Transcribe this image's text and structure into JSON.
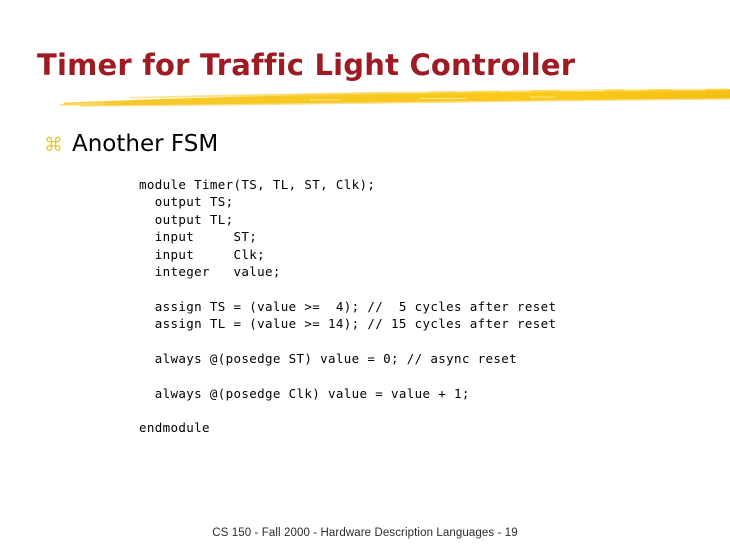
{
  "slide": {
    "title": "Timer for Traffic Light Controller",
    "title_color": "#9e1b24",
    "background_color": "#ffffff",
    "accent_color": "#f5c220"
  },
  "bullet": {
    "glyph": "⌘",
    "glyph_name": "wingdings-z-bullet",
    "glyph_color": "#e8c832",
    "text": "Another FSM"
  },
  "code": {
    "language": "verilog",
    "lines": [
      "module Timer(TS, TL, ST, Clk);",
      "  output TS;",
      "  output TL;",
      "  input     ST;",
      "  input     Clk;",
      "  integer   value;",
      "",
      "  assign TS = (value >=  4); //  5 cycles after reset",
      "  assign TL = (value >= 14); // 15 cycles after reset",
      "",
      "  always @(posedge ST) value = 0; // async reset",
      "",
      "  always @(posedge Clk) value = value + 1;",
      "",
      "endmodule"
    ]
  },
  "footer": {
    "text": "CS 150 - Fall 2000 - Hardware Description Languages - 19"
  }
}
